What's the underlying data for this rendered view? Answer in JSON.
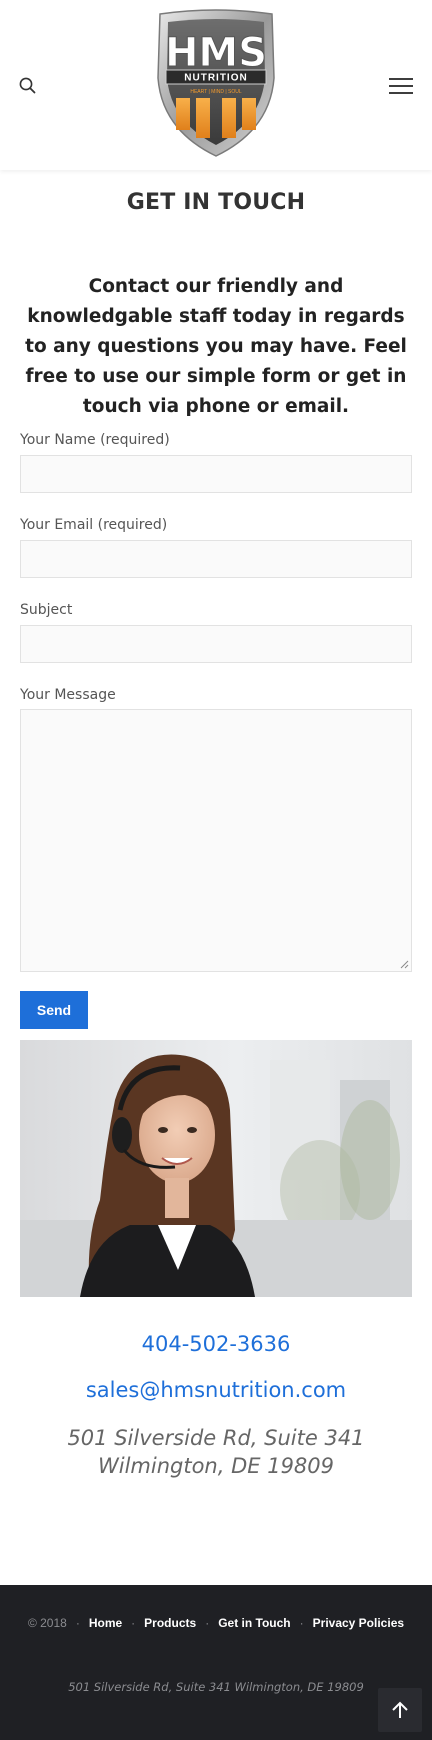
{
  "header": {
    "logo_text": "HMS",
    "logo_subtext": "NUTRITION",
    "logo_tagline": "HEART | MIND | SOUL"
  },
  "title": "GET IN TOUCH",
  "intro": "Contact our friendly and knowledgable staff today in regards to any questions you may have.  Feel free to use our simple form or get in touch via phone or email.",
  "form": {
    "name_label": "Your Name (required)",
    "name_value": "",
    "email_label": "Your Email (required)",
    "email_value": "",
    "subject_label": "Subject",
    "subject_value": "",
    "message_label": "Your Message",
    "message_value": "",
    "send_label": "Send"
  },
  "contact": {
    "phone": "404-502-3636",
    "email": "sales@hmsnutrition.com",
    "address_line1": "501 Silverside Rd, Suite 341",
    "address_line2": "Wilmington, DE 19809"
  },
  "footer": {
    "copyright": "© 2018",
    "links": [
      "Home",
      "Products",
      "Get in Touch",
      "Privacy Policies"
    ],
    "address": "501 Silverside Rd, Suite 341 Wilmington, DE 19809"
  },
  "icons": {
    "search": "search-icon",
    "menu": "hamburger-menu-icon",
    "back_to_top": "arrow-up-icon",
    "resize": "resize-grip-icon"
  },
  "colors": {
    "accent": "#1e6fd9",
    "footer_bg": "#1f2024",
    "logo_orange": "#f39a2c"
  }
}
